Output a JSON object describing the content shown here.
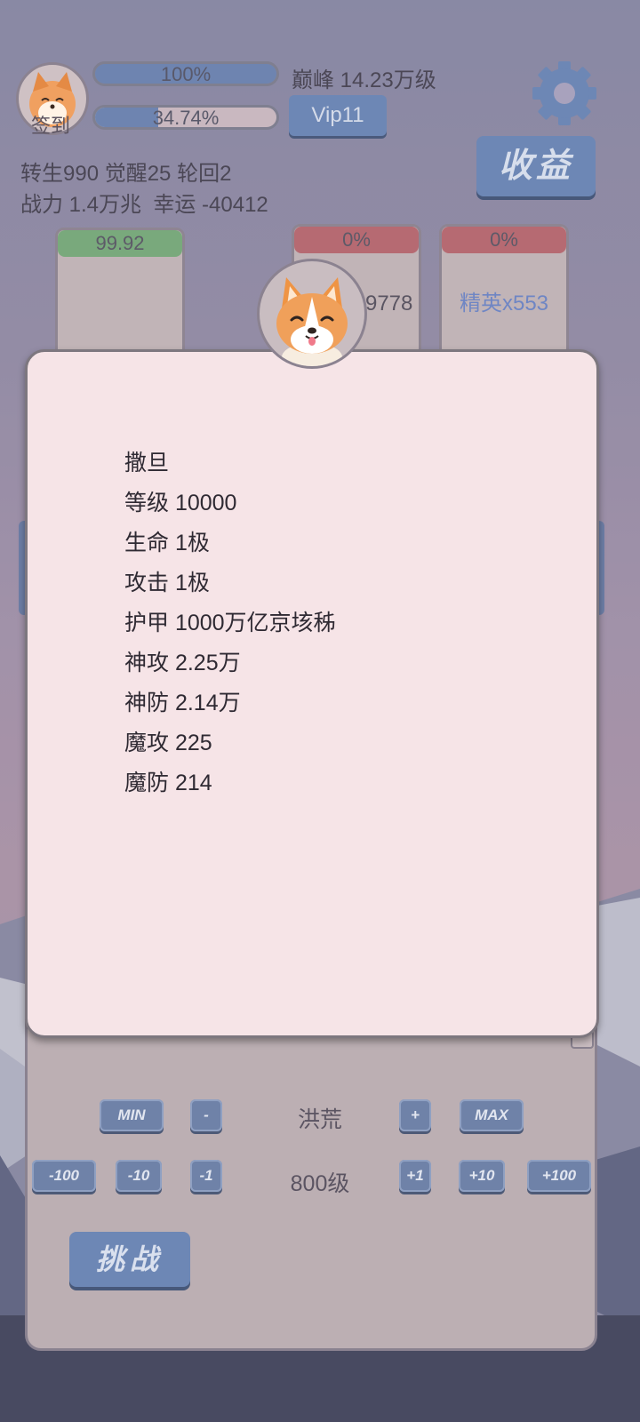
{
  "header": {
    "signin_label": "签到",
    "hp_bar": {
      "percent_text": "100%",
      "fill": 1.0
    },
    "exp_bar": {
      "percent_text": "34.74%",
      "fill": 0.3474
    },
    "peak_level": "巅峰 14.23万级",
    "vip_label": "Vip11",
    "stats_line1": "转生990 觉醒25 轮回2",
    "stats_line2": "战力 1.4万兆  幸运 -40412",
    "income_label": "收益"
  },
  "cards": [
    {
      "bar_text": "99.92",
      "bar_color": "green",
      "body_text": ""
    },
    {
      "bar_text": "0%",
      "bar_color": "red",
      "body_text": "小怪x29778"
    },
    {
      "bar_text": "0%",
      "bar_color": "red",
      "body_text": "精英x553"
    }
  ],
  "monster_info": {
    "name": "撒旦",
    "stats": [
      "等级 10000",
      "生命 1极",
      "攻击 1极",
      "护甲 1000万亿京垓秭",
      "神攻 2.25万",
      "神防 2.14万",
      "魔攻 225",
      "魔防 214"
    ]
  },
  "stage_controls": {
    "min_label": "MIN",
    "minus_label": "-",
    "region_name": "洪荒",
    "plus_label": "+",
    "max_label": "MAX",
    "minus100": "-100",
    "minus10": "-10",
    "minus1": "-1",
    "level_text": "800级",
    "plus1": "+1",
    "plus10": "+10",
    "plus100": "+100",
    "challenge_label": "挑战"
  },
  "colors": {
    "accent_blue": "#6d87b5",
    "modal_bg": "#f6e4e7",
    "elite_text": "#6f86c4"
  }
}
